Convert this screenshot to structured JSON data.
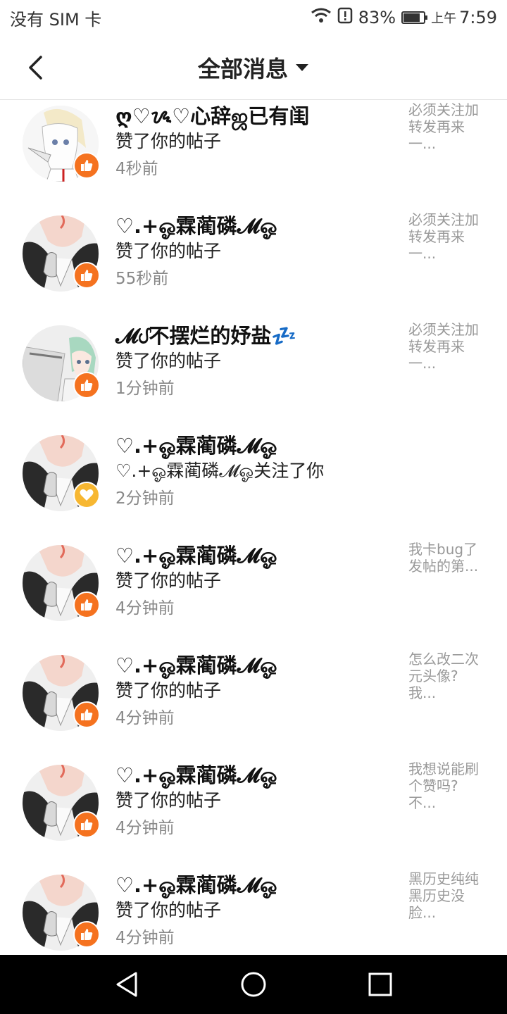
{
  "status_bar": {
    "carrier": "没有 SIM 卡",
    "battery_percent": "83%",
    "battery_level": 0.83,
    "ampm": "上午",
    "time": "7:59"
  },
  "header": {
    "title": "全部消息"
  },
  "messages": [
    {
      "name": "ღ♡ᝰ♡心辞ஜ已有闺",
      "action": "赞了你的帖子",
      "time": "4秒前",
      "preview": "必须关注加\n转发再来\n一...",
      "type": "like",
      "avatar": "anime-girl-white-hair"
    },
    {
      "name": "♡.+ஓ霖蔺磷𝓜ஓ",
      "action": "赞了你的帖子",
      "time": "55秒前",
      "preview": "必须关注加\n转发再来\n一...",
      "type": "like",
      "avatar": "anime-thumbs-up"
    },
    {
      "name": "𝓜ᦔ不摆烂的妤盐💤",
      "action": "赞了你的帖子",
      "time": "1分钟前",
      "preview": "必须关注加\n转发再来\n一...",
      "type": "like",
      "avatar": "anime-green-hair"
    },
    {
      "name": "♡.+ஓ霖蔺磷𝓜ஓ",
      "action": "♡.+ஓ霖蔺磷𝓜ஓ关注了你",
      "time": "2分钟前",
      "preview": "",
      "type": "follow",
      "avatar": "anime-thumbs-up"
    },
    {
      "name": "♡.+ஓ霖蔺磷𝓜ஓ",
      "action": "赞了你的帖子",
      "time": "4分钟前",
      "preview": "我卡bug了\n发帖的第...",
      "type": "like",
      "avatar": "anime-thumbs-up"
    },
    {
      "name": "♡.+ஓ霖蔺磷𝓜ஓ",
      "action": "赞了你的帖子",
      "time": "4分钟前",
      "preview": "怎么改二次\n元头像?\n我...",
      "type": "like",
      "avatar": "anime-thumbs-up"
    },
    {
      "name": "♡.+ஓ霖蔺磷𝓜ஓ",
      "action": "赞了你的帖子",
      "time": "4分钟前",
      "preview": "我想说能刷\n个赞吗?\n不...",
      "type": "like",
      "avatar": "anime-thumbs-up"
    },
    {
      "name": "♡.+ஓ霖蔺磷𝓜ஓ",
      "action": "赞了你的帖子",
      "time": "4分钟前",
      "preview": "黑历史纯纯\n黑历史没\n脸...",
      "type": "like",
      "avatar": "anime-thumbs-up"
    }
  ],
  "icons": {
    "back": "chevron-left-icon",
    "dropdown": "caret-down-icon",
    "like_badge": "thumbs-up-icon",
    "follow_badge": "heart-icon",
    "nav_back": "triangle-back-icon",
    "nav_home": "circle-home-icon",
    "nav_recent": "square-recent-icon"
  },
  "colors": {
    "like_badge": "#f5721f",
    "follow_badge": "#f7b731",
    "nav_bar": "#000000"
  }
}
